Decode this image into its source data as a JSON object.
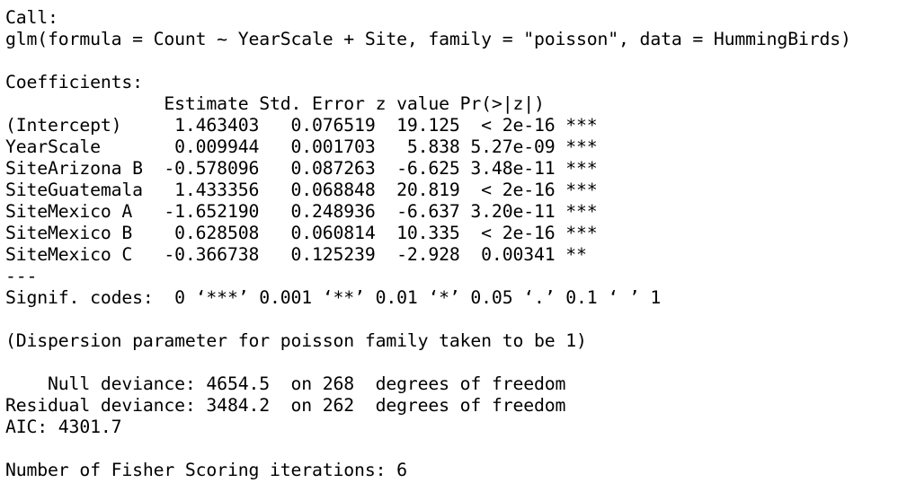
{
  "output": {
    "call_header": "Call:",
    "call_text": "glm(formula = Count ~ YearScale + Site, family = \"poisson\", data = HummingBirds)",
    "blank_1": "",
    "coefficients_header": "Coefficients:",
    "coef_table_header": "               Estimate Std. Error z value Pr(>|z|)    ",
    "coef_rows": [
      "(Intercept)     1.463403   0.076519  19.125  < 2e-16 ***",
      "YearScale       0.009944   0.001703   5.838 5.27e-09 ***",
      "SiteArizona B  -0.578096   0.087263  -6.625 3.48e-11 ***",
      "SiteGuatemala   1.433356   0.068848  20.819  < 2e-16 ***",
      "SiteMexico A   -1.652190   0.248936  -6.637 3.20e-11 ***",
      "SiteMexico B    0.628508   0.060814  10.335  < 2e-16 ***",
      "SiteMexico C   -0.366738   0.125239  -2.928  0.00341 ** "
    ],
    "separator": "---",
    "signif_codes": "Signif. codes:  0 ‘***’ 0.001 ‘**’ 0.01 ‘*’ 0.05 ‘.’ 0.1 ‘ ’ 1",
    "blank_2": "",
    "dispersion": "(Dispersion parameter for poisson family taken to be 1)",
    "blank_3": "",
    "null_deviance": "    Null deviance: 4654.5  on 268  degrees of freedom",
    "residual_deviance": "Residual deviance: 3484.2  on 262  degrees of freedom",
    "aic": "AIC: 4301.7",
    "blank_4": "",
    "fisher_iterations": "Number of Fisher Scoring iterations: 6"
  }
}
